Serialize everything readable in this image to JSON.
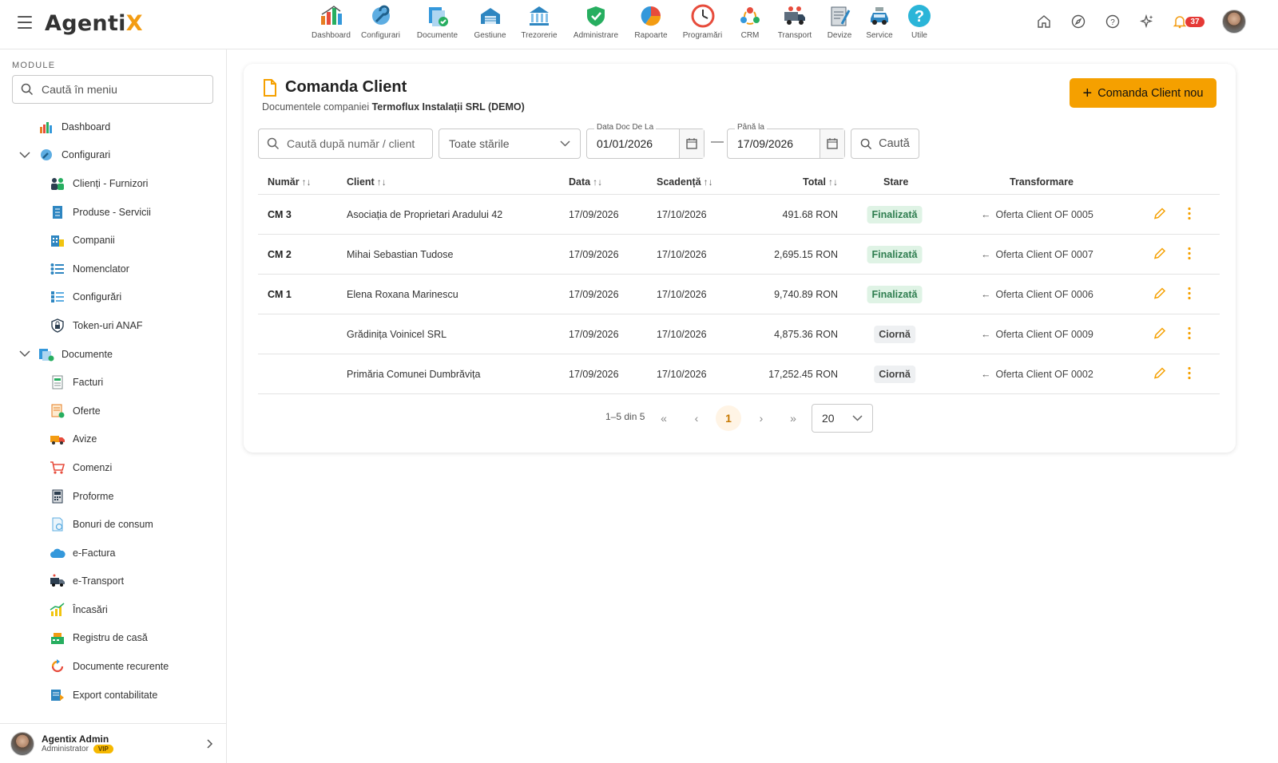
{
  "app": {
    "logo_main": "Agenti",
    "logo_accent": "X"
  },
  "nav": [
    {
      "label": "Dashboard",
      "icon": "dashboard-icon"
    },
    {
      "label": "Configurari",
      "icon": "wrench-icon"
    },
    {
      "label": "Documente",
      "icon": "documents-icon"
    },
    {
      "label": "Gestiune",
      "icon": "warehouse-icon"
    },
    {
      "label": "Trezorerie",
      "icon": "bank-icon"
    },
    {
      "label": "Administrare",
      "icon": "shield-icon"
    },
    {
      "label": "Rapoarte",
      "icon": "reports-icon"
    },
    {
      "label": "Programări",
      "icon": "clock-icon"
    },
    {
      "label": "CRM",
      "icon": "crm-icon"
    },
    {
      "label": "Transport",
      "icon": "truck-icon"
    },
    {
      "label": "Devize",
      "icon": "estimate-icon"
    },
    {
      "label": "Service",
      "icon": "car-service-icon"
    },
    {
      "label": "Utile",
      "icon": "help-icon"
    }
  ],
  "topright": {
    "notifications_count": "37"
  },
  "sidebar": {
    "section_title": "MODULE",
    "search_placeholder": "Caută în meniu",
    "items": [
      {
        "label": "Dashboard",
        "level": 1
      },
      {
        "label": "Configurari",
        "level": 1,
        "expanded": true
      },
      {
        "label": "Clienți - Furnizori",
        "level": 2
      },
      {
        "label": "Produse - Servicii",
        "level": 2
      },
      {
        "label": "Companii",
        "level": 2
      },
      {
        "label": "Nomenclator",
        "level": 2
      },
      {
        "label": "Configurări",
        "level": 2
      },
      {
        "label": "Token-uri ANAF",
        "level": 2
      },
      {
        "label": "Documente",
        "level": 1,
        "expanded": true
      },
      {
        "label": "Facturi",
        "level": 2
      },
      {
        "label": "Oferte",
        "level": 2
      },
      {
        "label": "Avize",
        "level": 2
      },
      {
        "label": "Comenzi",
        "level": 2
      },
      {
        "label": "Proforme",
        "level": 2
      },
      {
        "label": "Bonuri de consum",
        "level": 2
      },
      {
        "label": "e-Factura",
        "level": 2
      },
      {
        "label": "e-Transport",
        "level": 2
      },
      {
        "label": "Încasări",
        "level": 2
      },
      {
        "label": "Registru de casă",
        "level": 2
      },
      {
        "label": "Documente recurente",
        "level": 2
      },
      {
        "label": "Export contabilitate",
        "level": 2
      }
    ],
    "user": {
      "name": "Agentix Admin",
      "role": "Administrator",
      "badge": "VIP"
    }
  },
  "page": {
    "title": "Comanda Client",
    "subtitle_prefix": "Documentele companiei ",
    "company": "Termoflux Instalații SRL (DEMO)",
    "new_button": "Comanda Client nou"
  },
  "filters": {
    "search_placeholder": "Caută după număr / client",
    "status_value": "Toate stările",
    "date_from_label": "Data Doc De La",
    "date_from": "01/01/2026",
    "date_to_label": "Până la",
    "date_to": "17/09/2026",
    "search_button": "Caută"
  },
  "table": {
    "headers": {
      "number": "Număr",
      "client": "Client",
      "date": "Data",
      "due": "Scadență",
      "total": "Total",
      "status": "Stare",
      "transform": "Transformare"
    },
    "rows": [
      {
        "number": "CM 3",
        "client": "Asociația de Proprietari Aradului 42",
        "date": "17/09/2026",
        "due": "17/10/2026",
        "total": "491.68 RON",
        "status": "Finalizată",
        "status_type": "fin",
        "transform": "Oferta Client OF 0005"
      },
      {
        "number": "CM 2",
        "client": "Mihai Sebastian Tudose",
        "date": "17/09/2026",
        "due": "17/10/2026",
        "total": "2,695.15 RON",
        "status": "Finalizată",
        "status_type": "fin",
        "transform": "Oferta Client OF 0007"
      },
      {
        "number": "CM 1",
        "client": "Elena Roxana Marinescu",
        "date": "17/09/2026",
        "due": "17/10/2026",
        "total": "9,740.89 RON",
        "status": "Finalizată",
        "status_type": "fin",
        "transform": "Oferta Client OF 0006"
      },
      {
        "number": "",
        "client": "Grădinița Voinicel SRL",
        "date": "17/09/2026",
        "due": "17/10/2026",
        "total": "4,875.36 RON",
        "status": "Ciornă",
        "status_type": "cio",
        "transform": "Oferta Client OF 0009"
      },
      {
        "number": "",
        "client": "Primăria Comunei Dumbrăvița",
        "date": "17/09/2026",
        "due": "17/10/2026",
        "total": "17,252.45 RON",
        "status": "Ciornă",
        "status_type": "cio",
        "transform": "Oferta Client OF 0002"
      }
    ]
  },
  "pagination": {
    "info": "1–5 din 5",
    "current_page": "1",
    "page_size": "20"
  },
  "colors": {
    "accent": "#f5a000",
    "status_done_bg": "#dff3e5",
    "status_done_fg": "#2e7d4f",
    "status_draft_bg": "#eef0f2"
  }
}
